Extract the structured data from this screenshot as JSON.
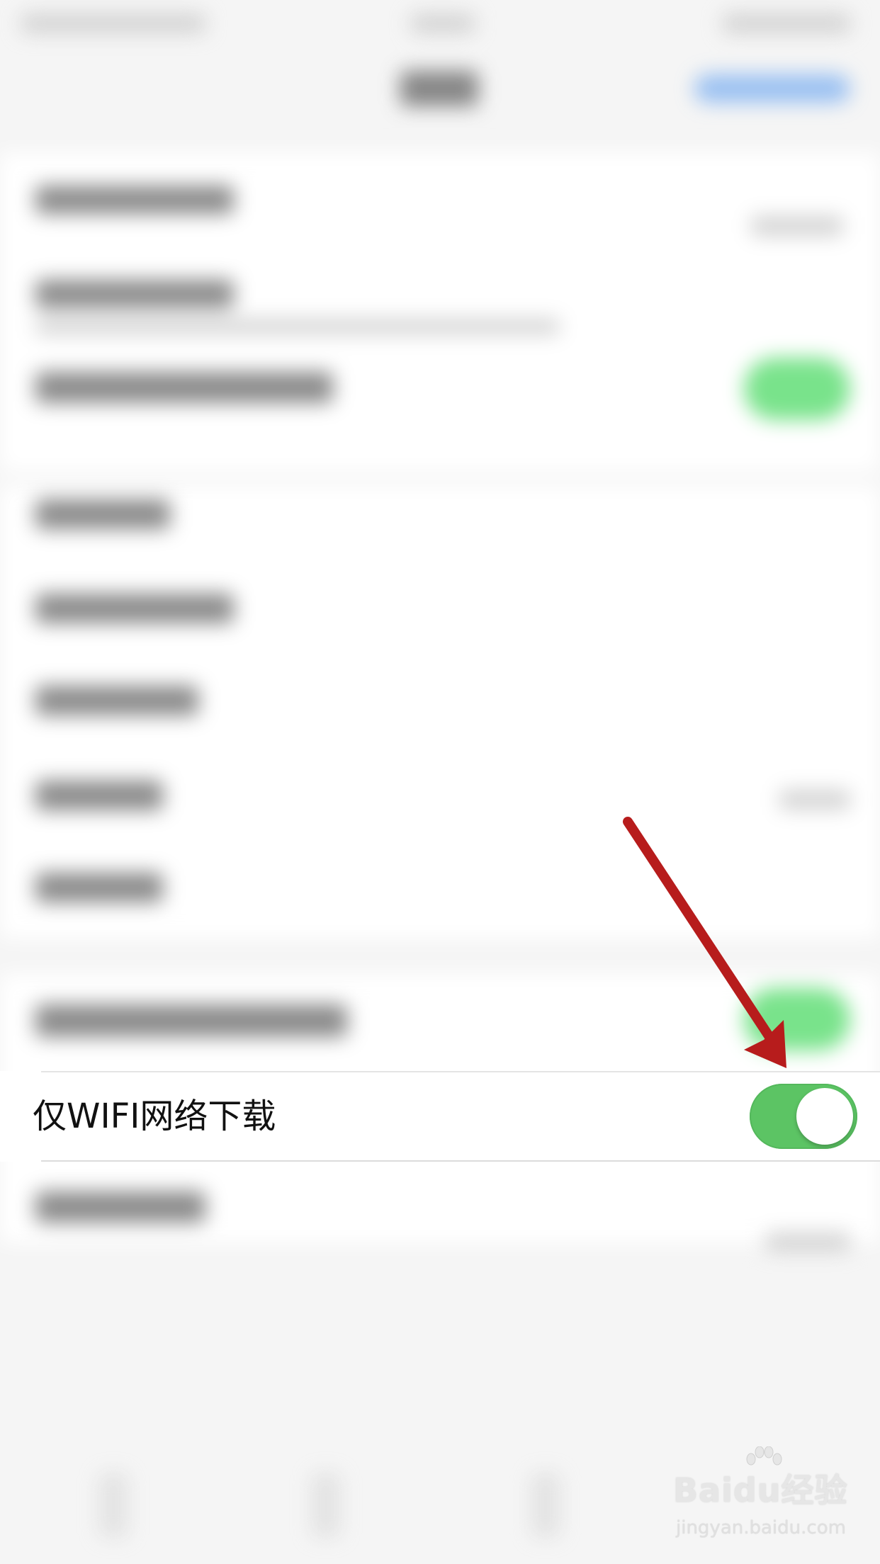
{
  "settings": {
    "wifi_only_download": {
      "label": "仅WIFI网络下载",
      "enabled": true
    }
  },
  "colors": {
    "toggle_on": "#5cc464",
    "annotation_arrow": "#b71c1c",
    "background": "#f5f5f5"
  },
  "icons": {
    "annotation": "arrow-icon",
    "watermark_logo": "baidu-paw-icon"
  },
  "watermark": {
    "brand": "Baidu经验",
    "url": "jingyan.baidu.com"
  }
}
